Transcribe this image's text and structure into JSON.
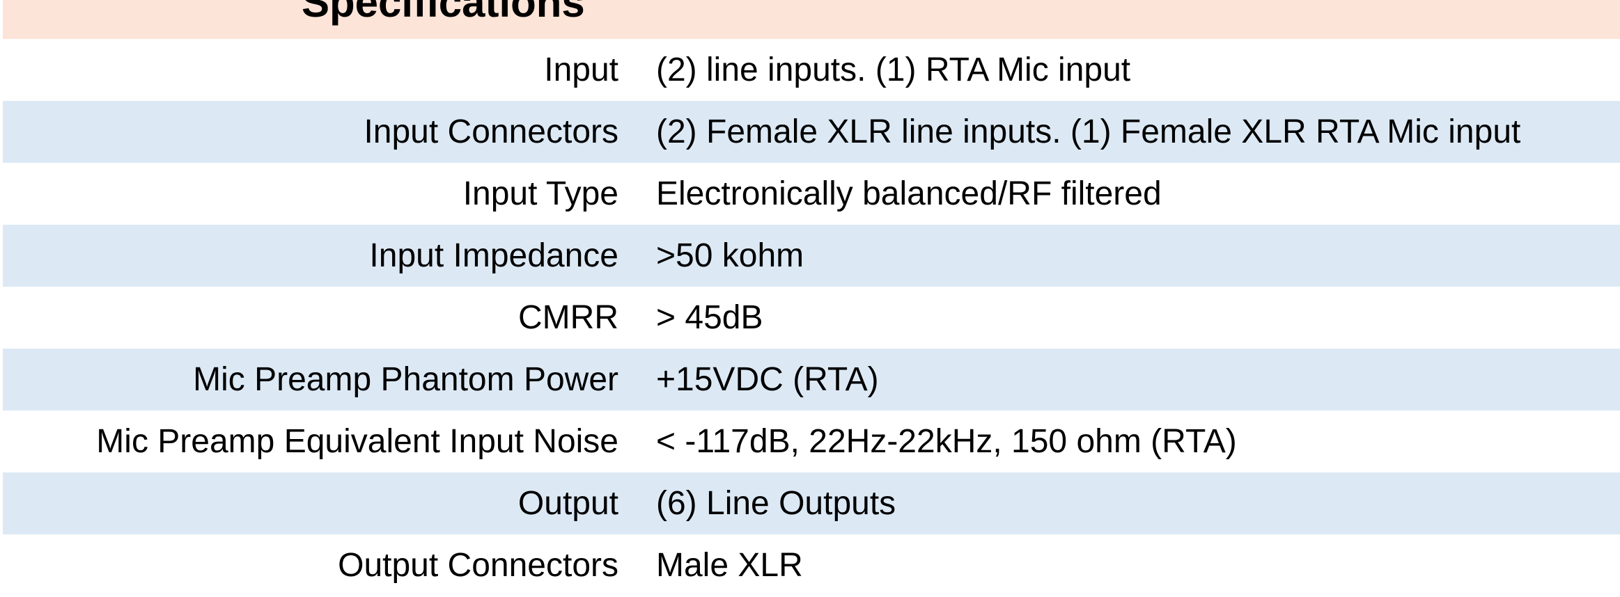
{
  "header": {
    "title": "Specifications"
  },
  "colors": {
    "header_background": "#fde4d8",
    "row_shaded": "#dce9f5",
    "row_plain": "#ffffff"
  },
  "specs": [
    {
      "label": "Input",
      "value": "(2) line inputs. (1) RTA Mic input"
    },
    {
      "label": "Input Connectors",
      "value": "(2) Female XLR line inputs. (1) Female XLR RTA Mic input"
    },
    {
      "label": "Input Type",
      "value": "Electronically balanced/RF filtered"
    },
    {
      "label": "Input Impedance",
      "value": ">50 kohm"
    },
    {
      "label": "CMRR",
      "value": "> 45dB"
    },
    {
      "label": "Mic Preamp Phantom Power",
      "value": "+15VDC (RTA)"
    },
    {
      "label": "Mic Preamp Equivalent Input Noise",
      "value": "< -117dB, 22Hz-22kHz, 150 ohm (RTA)"
    },
    {
      "label": "Output",
      "value": "(6) Line Outputs"
    },
    {
      "label": "Output Connectors",
      "value": "Male XLR"
    }
  ]
}
